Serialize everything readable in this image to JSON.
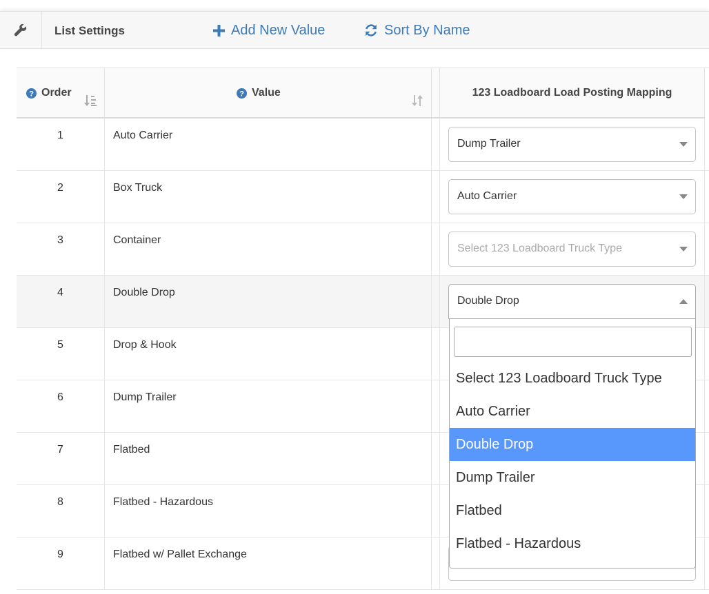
{
  "toolbar": {
    "icon": "wrench-icon",
    "title": "List Settings",
    "add_label": "Add New Value",
    "sort_label": "Sort By Name"
  },
  "columns": {
    "order": "Order",
    "value": "Value",
    "mapping": "123 Loadboard Load Posting Mapping"
  },
  "rows": [
    {
      "order": "1",
      "value": "Auto Carrier",
      "mapping": "Dump Trailer"
    },
    {
      "order": "2",
      "value": "Box Truck",
      "mapping": "Auto Carrier"
    },
    {
      "order": "3",
      "value": "Container",
      "mapping": "Select 123 Loadboard Truck Type"
    },
    {
      "order": "4",
      "value": "Double Drop",
      "mapping": "Double Drop"
    },
    {
      "order": "5",
      "value": "Drop & Hook",
      "mapping": ""
    },
    {
      "order": "6",
      "value": "Dump Trailer",
      "mapping": ""
    },
    {
      "order": "7",
      "value": "Flatbed",
      "mapping": ""
    },
    {
      "order": "8",
      "value": "Flatbed - Hazardous",
      "mapping": ""
    },
    {
      "order": "9",
      "value": "Flatbed w/ Pallet Exchange",
      "mapping": ""
    }
  ],
  "dropdown": {
    "search_value": "",
    "options": [
      "Select 123 Loadboard Truck Type",
      "Auto Carrier",
      "Double Drop",
      "Dump Trailer",
      "Flatbed",
      "Flatbed - Hazardous"
    ],
    "highlighted": "Double Drop"
  },
  "colors": {
    "accent": "#3d7ab8",
    "highlight": "#5897fb",
    "help_icon": "#3d7ab8"
  }
}
